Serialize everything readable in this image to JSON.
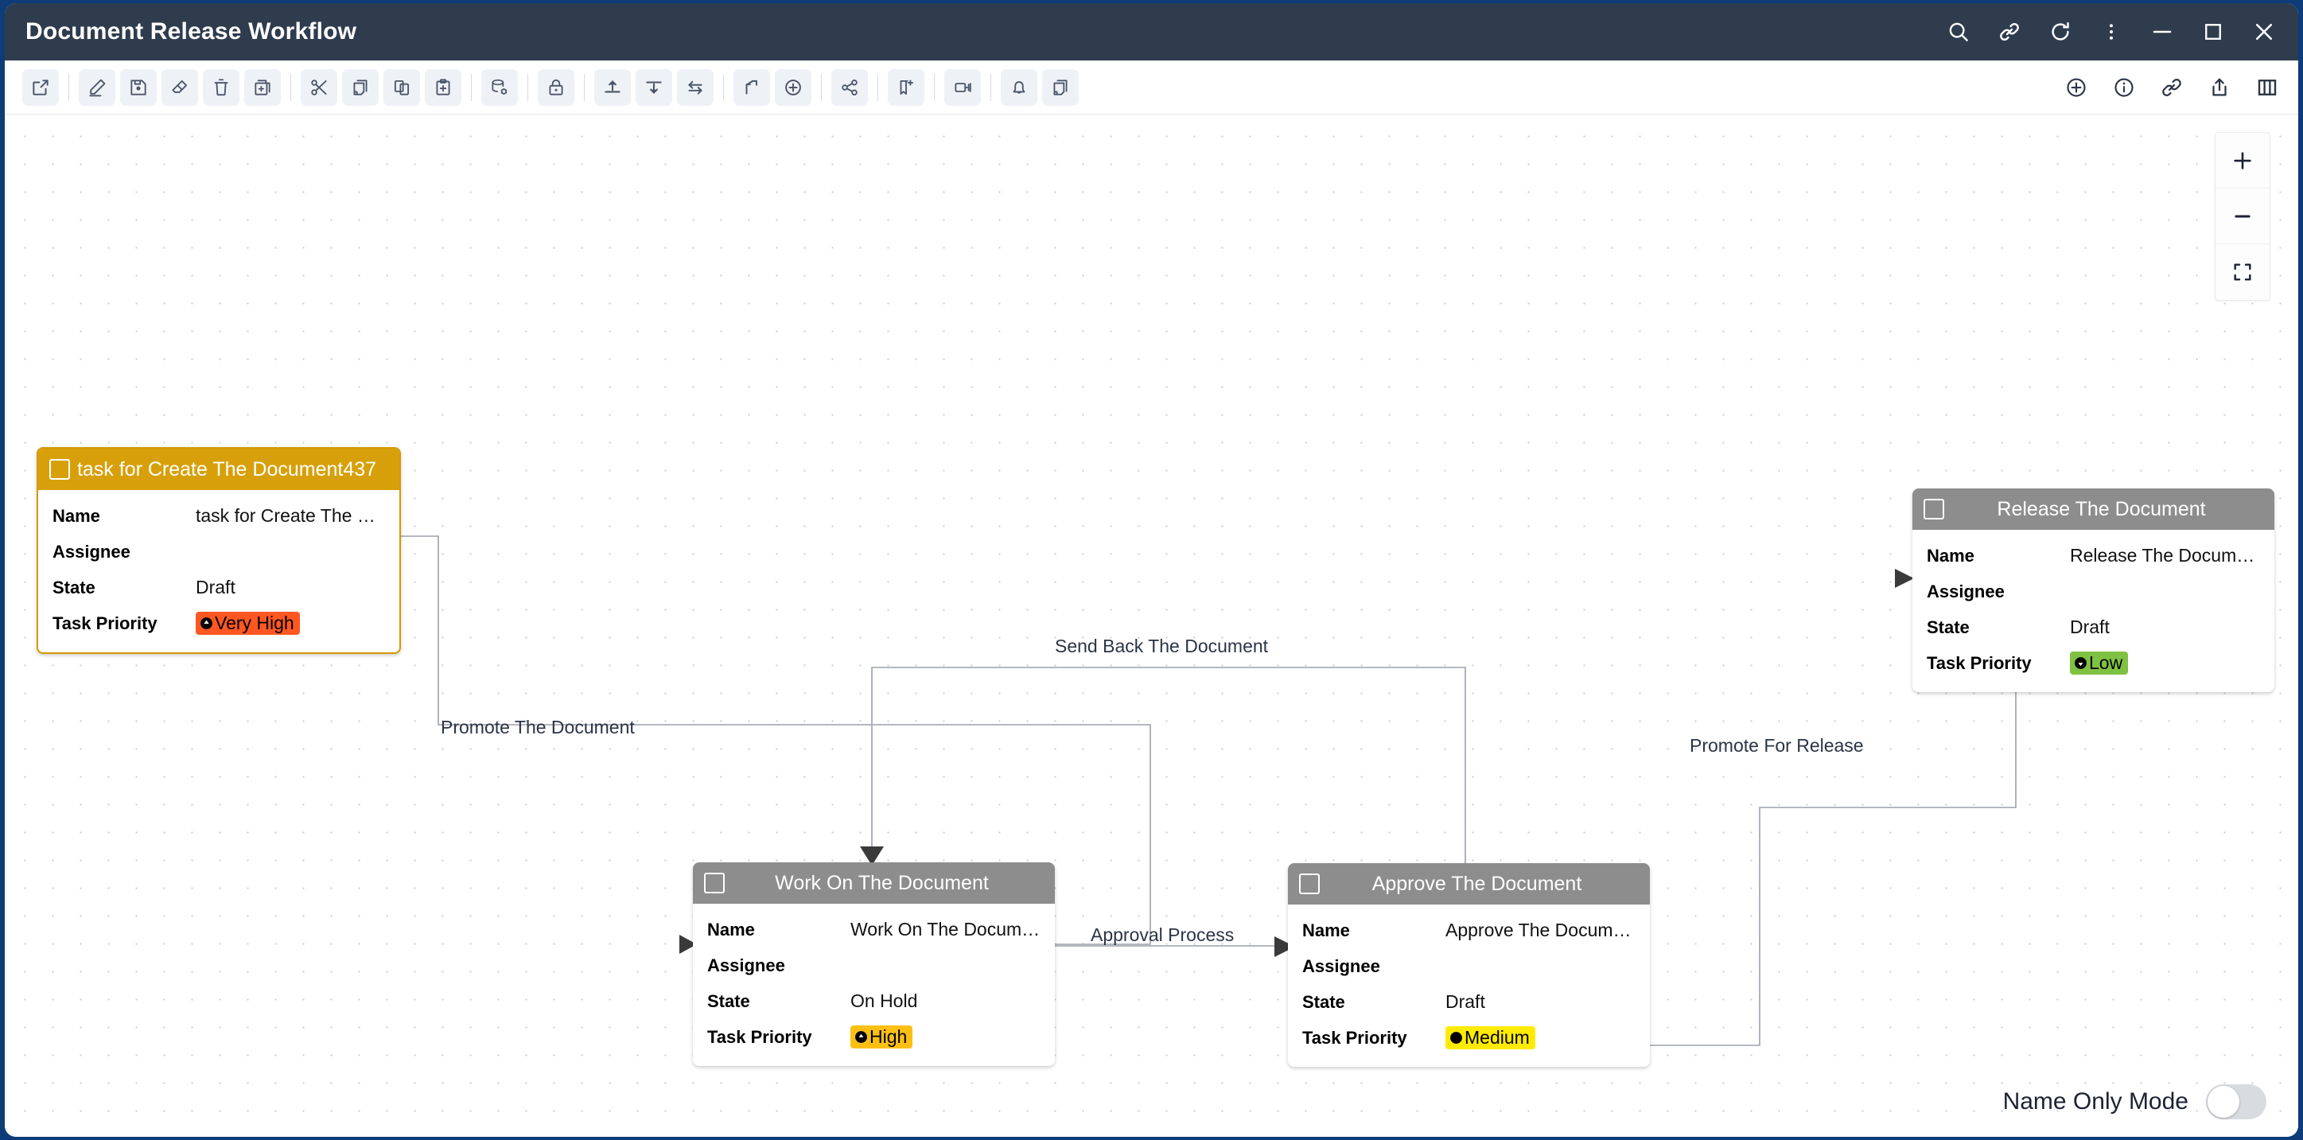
{
  "window": {
    "title": "Document Release Workflow",
    "controls": [
      {
        "name": "search-icon",
        "label": "Search"
      },
      {
        "name": "link-icon",
        "label": "Link"
      },
      {
        "name": "refresh-icon",
        "label": "Refresh"
      },
      {
        "name": "more-vertical-icon",
        "label": "More options"
      },
      {
        "name": "minimize-icon",
        "label": "Minimize"
      },
      {
        "name": "maximize-icon",
        "label": "Maximize"
      },
      {
        "name": "close-icon",
        "label": "Close"
      }
    ]
  },
  "toolbar": {
    "left_groups": [
      {
        "items": [
          {
            "name": "open-external-icon",
            "label": "Open in new window"
          }
        ]
      },
      {
        "items": [
          {
            "name": "edit-pencil-icon",
            "label": "Edit"
          },
          {
            "name": "save-icon",
            "label": "Save"
          },
          {
            "name": "eraser-icon",
            "label": "Erase"
          },
          {
            "name": "delete-trash-icon",
            "label": "Delete"
          },
          {
            "name": "duplicate-add-icon",
            "label": "Duplicate"
          }
        ]
      },
      {
        "items": [
          {
            "name": "cut-scissors-icon",
            "label": "Cut"
          },
          {
            "name": "copy-pages-icon",
            "label": "Copy"
          },
          {
            "name": "paste-icon",
            "label": "Paste"
          },
          {
            "name": "paste-special-icon",
            "label": "Paste special"
          }
        ]
      },
      {
        "items": [
          {
            "name": "database-settings-icon",
            "label": "Data settings"
          }
        ]
      },
      {
        "items": [
          {
            "name": "lock-icon",
            "label": "Lock"
          }
        ]
      },
      {
        "items": [
          {
            "name": "checkin-icon",
            "label": "Check in"
          },
          {
            "name": "checkout-icon",
            "label": "Check out"
          },
          {
            "name": "swap-arrows-icon",
            "label": "Swap"
          }
        ]
      },
      {
        "items": [
          {
            "name": "branch-icon",
            "label": "Branch"
          },
          {
            "name": "add-circle-icon",
            "label": "Add"
          }
        ]
      },
      {
        "items": [
          {
            "name": "share-nodes-icon",
            "label": "Share"
          }
        ]
      },
      {
        "items": [
          {
            "name": "bookmark-add-icon",
            "label": "Add bookmark"
          }
        ]
      },
      {
        "items": [
          {
            "name": "transfer-icon",
            "label": "Transfer"
          }
        ]
      },
      {
        "items": [
          {
            "name": "bell-icon",
            "label": "Notifications"
          },
          {
            "name": "pages-icon",
            "label": "Documents"
          }
        ]
      }
    ],
    "right_items": [
      {
        "name": "add-circle-icon",
        "label": "Add"
      },
      {
        "name": "info-circle-icon",
        "label": "Info"
      },
      {
        "name": "link-icon",
        "label": "Link"
      },
      {
        "name": "upload-share-icon",
        "label": "Export"
      },
      {
        "name": "columns-icon",
        "label": "Columns"
      }
    ]
  },
  "canvas": {
    "zoom_controls": [
      {
        "name": "zoom-in-button",
        "label": "+"
      },
      {
        "name": "zoom-out-button",
        "label": "−"
      },
      {
        "name": "fit-to-screen-button",
        "label": "Fit"
      }
    ],
    "name_only_mode": {
      "label": "Name Only Mode",
      "enabled": false
    },
    "row_keys": [
      "Name",
      "Assignee",
      "State",
      "Task Priority"
    ],
    "nodes": [
      {
        "id": "create",
        "title": "task for Create The Document437",
        "style": "amber",
        "header_color": "#d7a00a",
        "name": "task for Create The Do...",
        "assignee": "",
        "state": "Draft",
        "priority": {
          "label": "Very High",
          "bg": "#ff5722",
          "icon": "priority-very-high-icon"
        }
      },
      {
        "id": "work",
        "title": "Work On The Document",
        "style": "grey",
        "header_color": "#8d8d8d",
        "name": "Work On The Document",
        "assignee": "",
        "state": "On Hold",
        "priority": {
          "label": "High",
          "bg": "#fcc014",
          "icon": "priority-high-icon"
        }
      },
      {
        "id": "approve",
        "title": "Approve The Document",
        "style": "grey",
        "header_color": "#8d8d8d",
        "name": "Approve The Document",
        "assignee": "",
        "state": "Draft",
        "priority": {
          "label": "Medium",
          "bg": "#ffeb00",
          "icon": "priority-medium-icon"
        }
      },
      {
        "id": "release",
        "title": "Release The Document",
        "style": "grey",
        "header_color": "#8d8d8d",
        "name": "Release The Document",
        "assignee": "",
        "state": "Draft",
        "priority": {
          "label": "Low",
          "bg": "#7fc142",
          "icon": "priority-low-icon"
        }
      }
    ],
    "edges": [
      {
        "id": "promote-the-document",
        "label": "Promote The Document",
        "from": "create",
        "to": "work"
      },
      {
        "id": "send-back-the-document",
        "label": "Send Back The Document",
        "from": "approve",
        "to": "work"
      },
      {
        "id": "approval-process",
        "label": "Approval Process",
        "from": "work",
        "to": "approve"
      },
      {
        "id": "promote-for-release",
        "label": "Promote For Release",
        "from": "approve",
        "to": "release"
      }
    ]
  }
}
